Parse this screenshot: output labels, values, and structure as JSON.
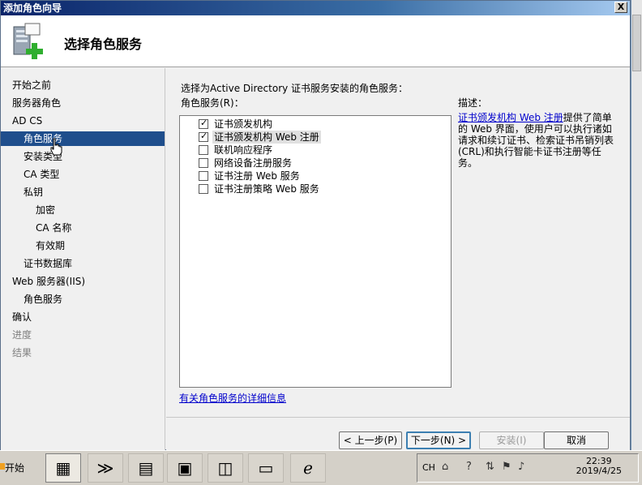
{
  "window": {
    "title": "添加角色向导",
    "close": "X"
  },
  "header": {
    "title": "选择角色服务"
  },
  "nav": [
    "开始之前",
    "服务器角色",
    "AD CS",
    "角色服务",
    "安装类型",
    "CA 类型",
    "私钥",
    "加密",
    "CA 名称",
    "有效期",
    "证书数据库",
    "Web 服务器(IIS)",
    "角色服务",
    "确认",
    "进度",
    "结果"
  ],
  "content": {
    "lead": "选择为Active Directory 证书服务安装的角色服务：",
    "roles_label": "角色服务(R)：",
    "roles": [
      {
        "label": "证书颁发机构",
        "checked": true
      },
      {
        "label": "证书颁发机构 Web 注册",
        "checked": true
      },
      {
        "label": "联机响应程序",
        "checked": false
      },
      {
        "label": "网络设备注册服务",
        "checked": false
      },
      {
        "label": "证书注册 Web 服务",
        "checked": false
      },
      {
        "label": "证书注册策略 Web 服务",
        "checked": false
      }
    ],
    "check_mark": "✓",
    "desc_title": "描述：",
    "desc_link": "证书颁发机构 Web 注册",
    "desc_text": "提供了简单的 Web 界面，使用户可以执行诸如请求和续订证书、检索证书吊销列表(CRL)和执行智能卡证书注册等任务。",
    "more_link": "有关角色服务的详细信息"
  },
  "buttons": {
    "prev": "< 上一步(P)",
    "next": "下一步(N) >",
    "install": "安装(I)",
    "cancel": "取消"
  },
  "taskbar": {
    "start": "开始",
    "lang": "CH",
    "time": "22:39",
    "date": "2019/4/25"
  },
  "colors": {
    "active_nav": "#1f4e8c",
    "titlebar": "#0a246a",
    "link": "#0000cc"
  }
}
